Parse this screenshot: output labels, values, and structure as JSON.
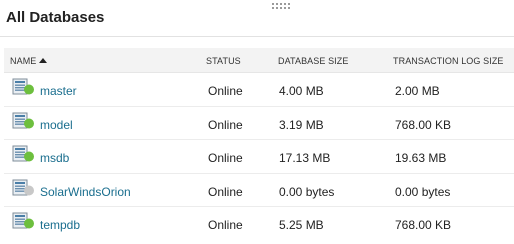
{
  "widget": {
    "title": "All Databases"
  },
  "table": {
    "columns": {
      "name": "NAME",
      "status": "STATUS",
      "database_size": "DATABASE SIZE",
      "log_size": "TRANSACTION LOG SIZE"
    },
    "sort": {
      "column": "name",
      "direction": "ascending"
    },
    "rows": [
      {
        "name": "master",
        "status": "Online",
        "database_size": "4.00 MB",
        "log_size": "2.00 MB",
        "status_color": "#6dbf3e"
      },
      {
        "name": "model",
        "status": "Online",
        "database_size": "3.19 MB",
        "log_size": "768.00 KB",
        "status_color": "#6dbf3e"
      },
      {
        "name": "msdb",
        "status": "Online",
        "database_size": "17.13 MB",
        "log_size": "19.63 MB",
        "status_color": "#6dbf3e"
      },
      {
        "name": "SolarWindsOrion",
        "status": "Online",
        "database_size": "0.00 bytes",
        "log_size": "0.00 bytes",
        "status_color": "#c8c8c8"
      },
      {
        "name": "tempdb",
        "status": "Online",
        "database_size": "5.25 MB",
        "log_size": "768.00 KB",
        "status_color": "#6dbf3e"
      }
    ]
  },
  "icons": {
    "database": "database-icon"
  },
  "colors": {
    "link": "#1a6e8e",
    "online": "#6dbf3e",
    "unknown": "#c8c8c8",
    "header_bg": "#f3f3f3"
  }
}
